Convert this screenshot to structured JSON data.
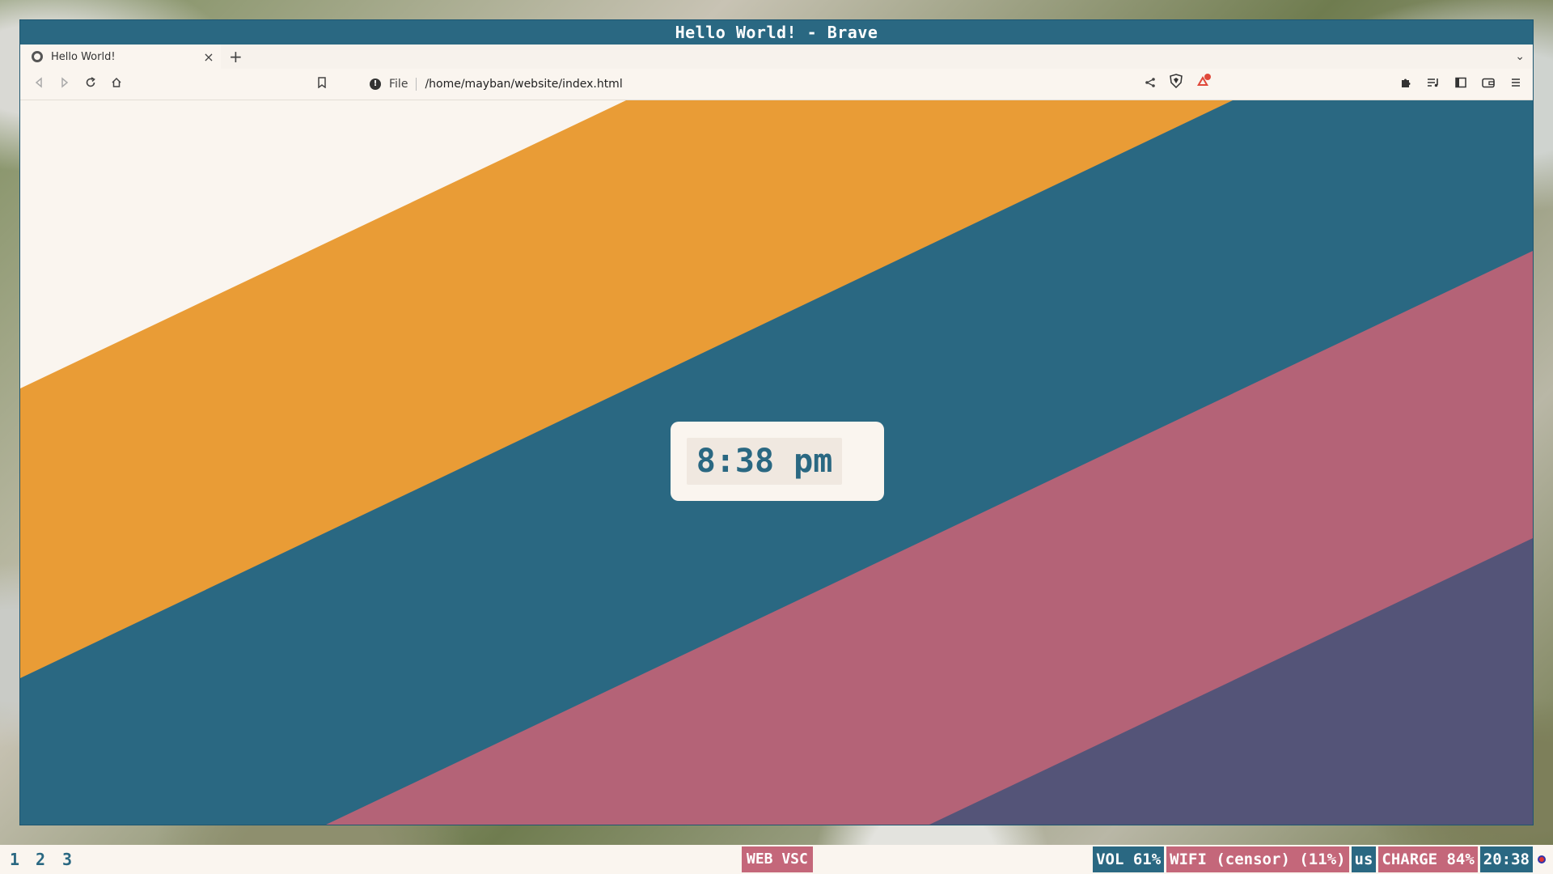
{
  "window": {
    "title": "Hello World! - Brave"
  },
  "tabs": [
    {
      "title": "Hello World!",
      "close": "×"
    }
  ],
  "new_tab": "+",
  "tab_menu": "⌄",
  "address": {
    "scheme": "File",
    "url": "/home/mayban/website/index.html"
  },
  "page": {
    "clock_text": "8:38 pm"
  },
  "colors": {
    "cream": "#faf5ef",
    "orange": "#e99c36",
    "teal": "#2a6882",
    "pink": "#b46377",
    "purple": "#545478"
  },
  "taskbar": {
    "workspaces": [
      "1",
      "2",
      "3"
    ],
    "apps": "WEB VSC",
    "volume": "VOL 61%",
    "wifi": "WIFI (censor) (11%)",
    "keyboard": "us",
    "charge": "CHARGE 84%",
    "time": "20:38"
  },
  "icons": {
    "back": "back-icon",
    "forward": "forward-icon",
    "reload": "reload-icon",
    "home": "home-icon",
    "bookmark": "bookmark-icon",
    "share": "share-icon",
    "brave_shield": "brave-shield-icon",
    "rewards": "brave-rewards-icon",
    "extensions": "extensions-icon",
    "playlist": "playlist-icon",
    "sidebar": "sidebar-icon",
    "wallet": "wallet-icon",
    "menu": "menu-icon"
  }
}
